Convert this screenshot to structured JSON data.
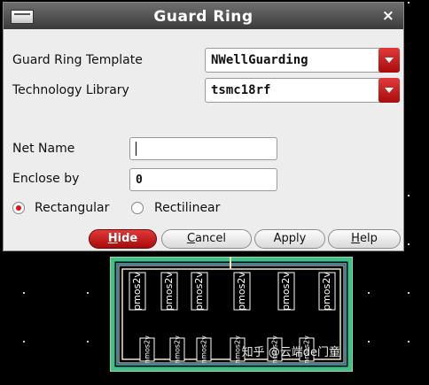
{
  "dialog": {
    "title": "Guard Ring",
    "close_glyph": "×",
    "guard_ring_template_label": "Guard Ring Template",
    "guard_ring_template_value": "NWellGuarding",
    "technology_library_label": "Technology Library",
    "technology_library_value": "tsmc18rf",
    "net_name_label": "Net Name",
    "net_name_value": "",
    "enclose_by_label": "Enclose by",
    "enclose_by_value": "0",
    "shape_options": [
      {
        "label": "Rectangular",
        "selected": true
      },
      {
        "label": "Rectilinear",
        "selected": false
      }
    ],
    "buttons": {
      "hide_first": "H",
      "hide_rest": "ide",
      "cancel_first": "C",
      "cancel_rest": "ancel",
      "apply": "Apply",
      "help_first": "H",
      "help_rest": "elp"
    }
  },
  "layout_preview": {
    "devices_top": [
      "pmos2v",
      "pmos2v",
      "pmos2v",
      "pmos2v",
      "pmos2v",
      "pmos2v"
    ],
    "devices_bottom": [
      "nmos2v",
      "nmos2v",
      "nmos2v",
      "nmos2v",
      "nmos2v",
      "nmos2v"
    ]
  },
  "watermark": "知乎 @云端de门童",
  "colors": {
    "accent_red": "#c41515",
    "guard_ring_green": "#3fbf8a",
    "outline_yellow": "#f2e8b0"
  }
}
